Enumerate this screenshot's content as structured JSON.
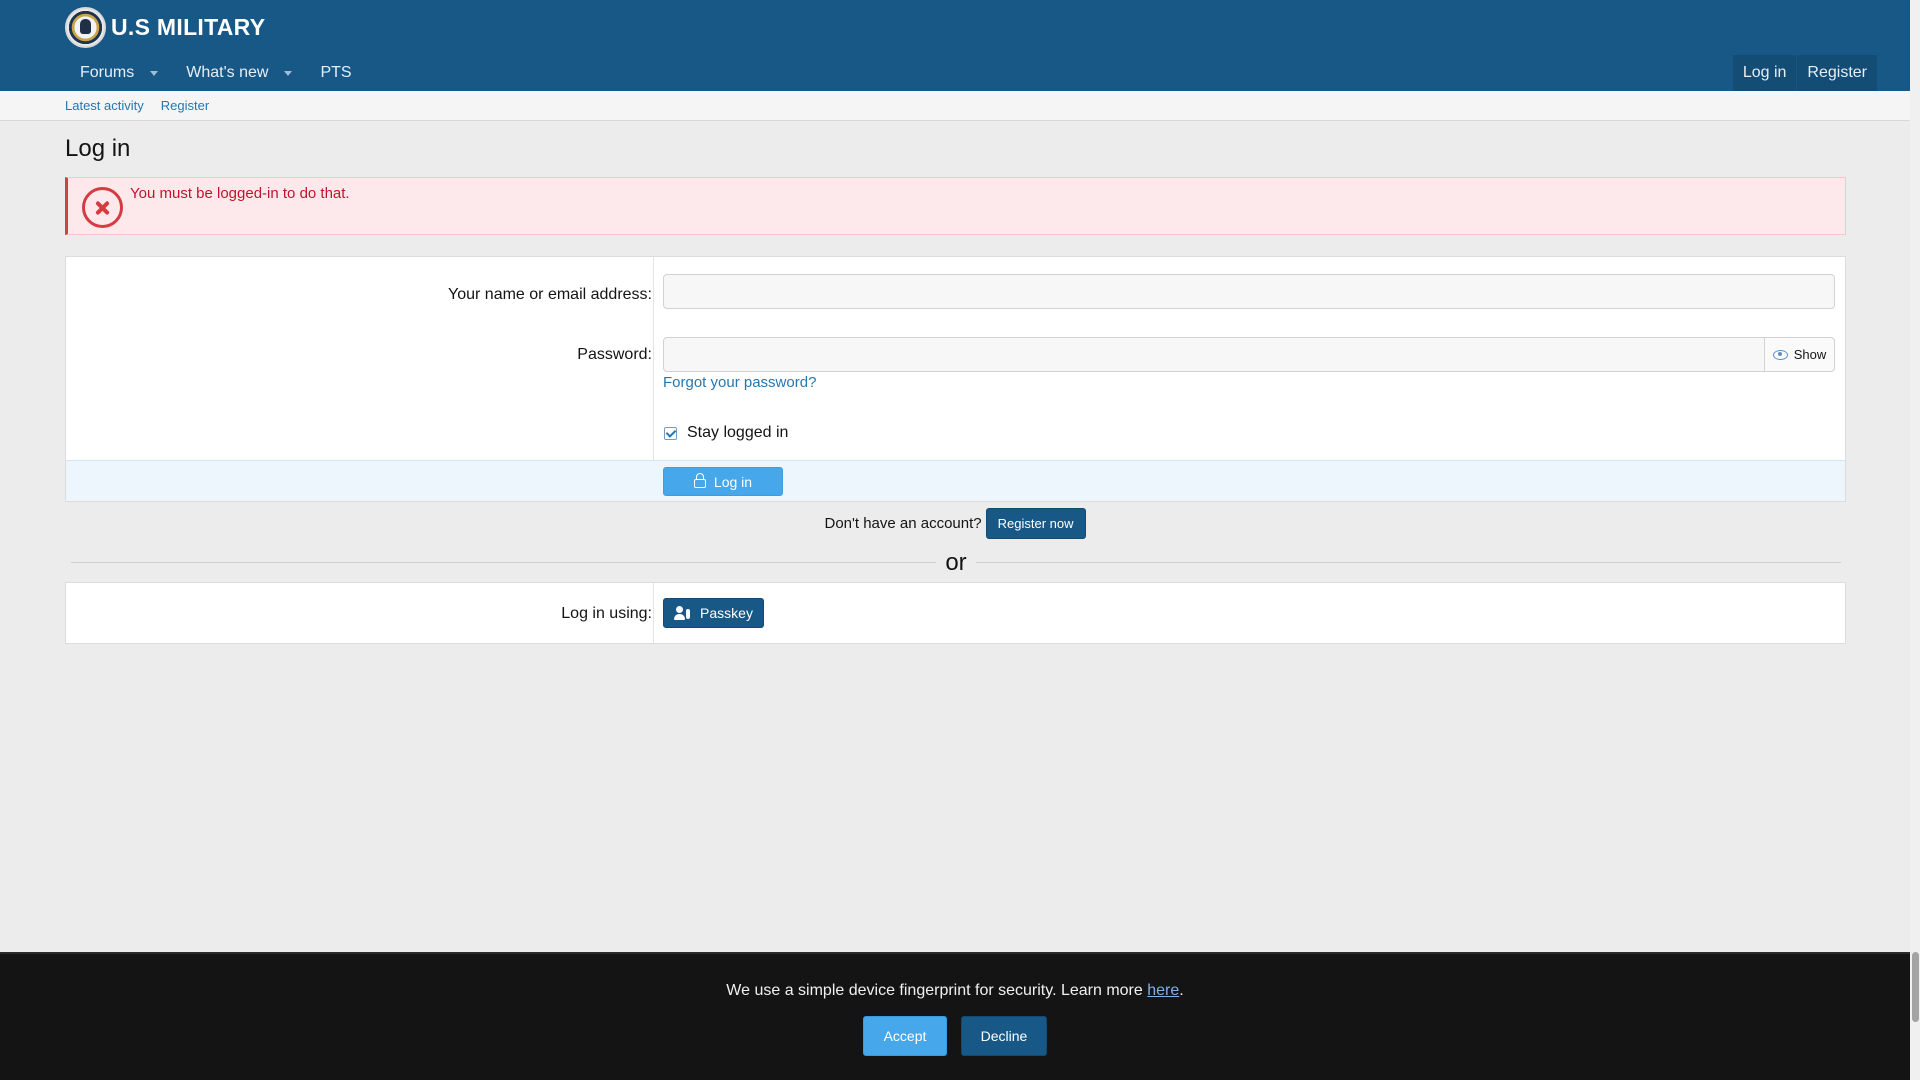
{
  "header": {
    "logo_text": "U.S MILITARY",
    "nav": {
      "forums": "Forums",
      "whats_new": "What's new",
      "pts": "PTS",
      "login": "Log in",
      "register": "Register"
    }
  },
  "subnav": {
    "latest_activity": "Latest activity",
    "register": "Register"
  },
  "page": {
    "title": "Log in"
  },
  "error": {
    "message": "You must be logged-in to do that."
  },
  "form": {
    "username_label": "Your name or email address:",
    "username_value": "",
    "password_label": "Password:",
    "password_value": "",
    "show_label": "Show",
    "forgot_password": "Forgot your password?",
    "stay_logged_in": "Stay logged in",
    "stay_logged_in_checked": true,
    "submit_label": "Log in"
  },
  "register_prompt": {
    "text": "Don't have an account?",
    "button": "Register now"
  },
  "separator": {
    "text": "or"
  },
  "passkey": {
    "label": "Log in using:",
    "button": "Passkey"
  },
  "cookie": {
    "text_before": "We use a simple device fingerprint for security. Learn more ",
    "link": "here",
    "text_after": ".",
    "accept": "Accept",
    "decline": "Decline"
  },
  "colors": {
    "header": "#185886",
    "accent": "#47a7eb",
    "error": "#c0142b",
    "link": "#2577b1"
  }
}
